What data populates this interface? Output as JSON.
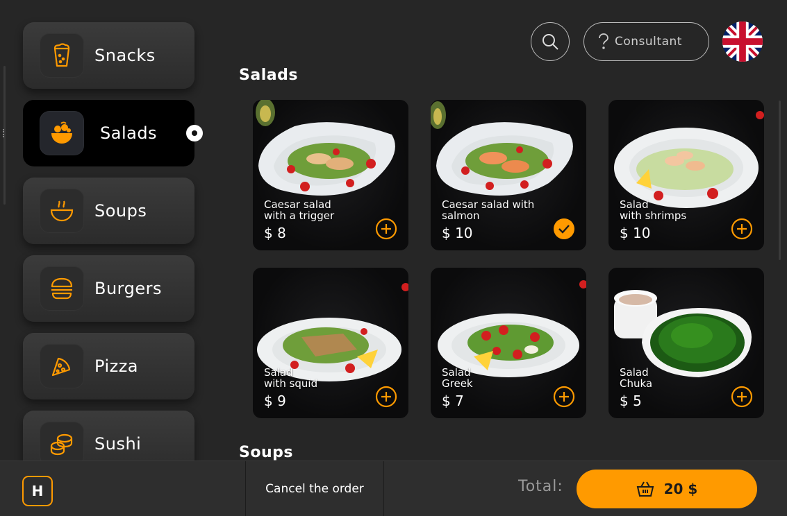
{
  "sidebar": {
    "items": [
      {
        "label": "Snacks",
        "icon": "snack-icon"
      },
      {
        "label": "Salads",
        "icon": "salad-bowl-icon",
        "active": true
      },
      {
        "label": "Soups",
        "icon": "soup-bowl-icon"
      },
      {
        "label": "Burgers",
        "icon": "burger-icon"
      },
      {
        "label": "Pizza",
        "icon": "pizza-slice-icon"
      },
      {
        "label": "Sushi",
        "icon": "sushi-icon"
      }
    ]
  },
  "header": {
    "search_icon": "search-icon",
    "consultant_label": "Consultant",
    "language_flag": "uk-flag-icon"
  },
  "sections": [
    {
      "title": "Salads",
      "items": [
        {
          "name_line1": "Caesar salad",
          "name_line2": "with a trigger",
          "price": "$ 8",
          "state": "add"
        },
        {
          "name_line1": "Caesar salad with",
          "name_line2": "salmon",
          "price": "$ 10",
          "state": "selected"
        },
        {
          "name_line1": "Salad",
          "name_line2": "with shrimps",
          "price": "$ 10",
          "state": "add"
        },
        {
          "name_line1": "Salad",
          "name_line2": "with squid",
          "price": "$ 9",
          "state": "add"
        },
        {
          "name_line1": "Salad",
          "name_line2": "Greek",
          "price": "$ 7",
          "state": "add"
        },
        {
          "name_line1": "Salad",
          "name_line2": "Chuka",
          "price": "$ 5",
          "state": "add"
        }
      ]
    },
    {
      "title": "Soups"
    }
  ],
  "footer": {
    "logo_letter": "H",
    "cancel_label": "Cancel the order",
    "total_label": "Total:",
    "total_amount": "20 $",
    "basket_icon": "basket-icon"
  },
  "colors": {
    "accent": "#ff9a00",
    "background": "#262626",
    "card_bg": "#111111"
  }
}
